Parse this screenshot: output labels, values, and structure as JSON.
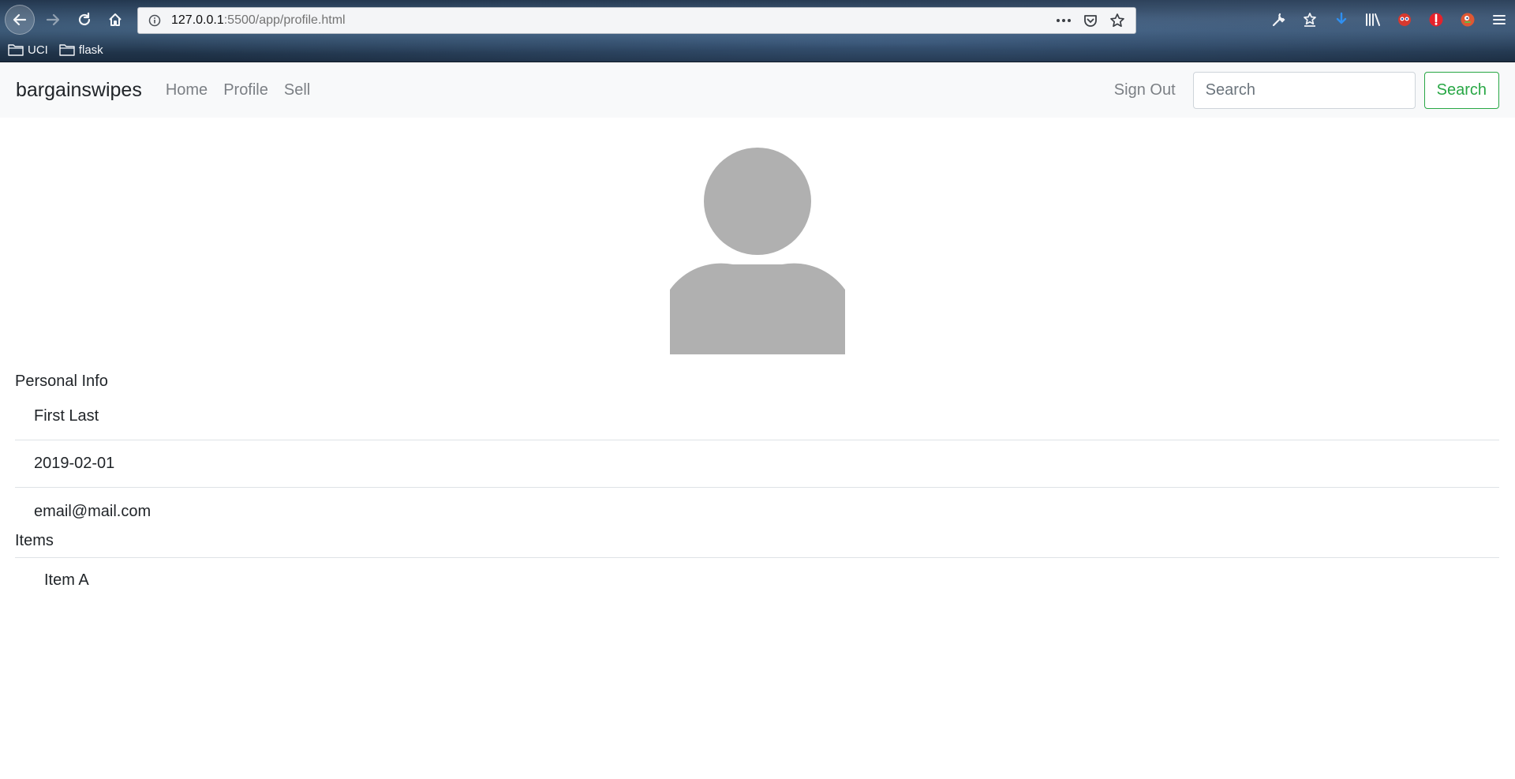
{
  "browser": {
    "url_host": "127.0.0.1",
    "url_rest": ":5500/app/profile.html",
    "bookmarks": [
      {
        "label": "UCI",
        "icon": "folder-icon"
      },
      {
        "label": "flask",
        "icon": "folder-icon"
      }
    ]
  },
  "navbar": {
    "brand": "bargainswipes",
    "links": [
      "Home",
      "Profile",
      "Sell"
    ],
    "sign_out": "Sign Out",
    "search_placeholder": "Search",
    "search_button": "Search",
    "search_button_color": "#28a745"
  },
  "profile": {
    "avatar_color": "#b0b0b0",
    "personal_info_title": "Personal Info",
    "name": "First Last",
    "date": "2019-02-01",
    "email": "email@mail.com",
    "items_title": "Items",
    "items": [
      "Item A"
    ]
  }
}
